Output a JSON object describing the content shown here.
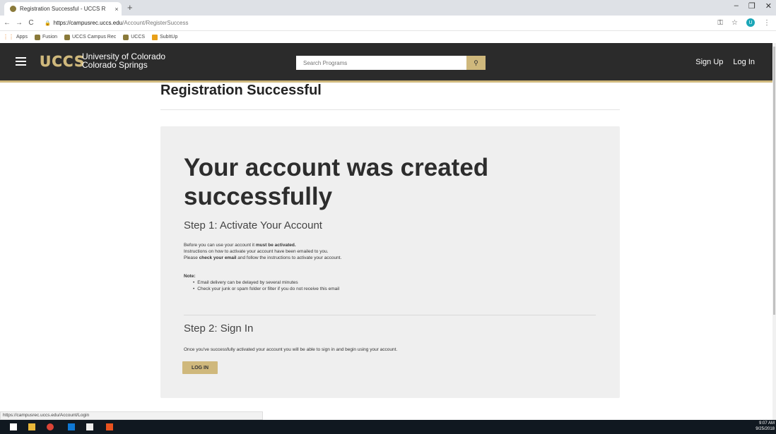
{
  "browser": {
    "tab_title": "Registration Successful - UCCS R",
    "tab_close": "×",
    "new_tab": "+",
    "url_host": "https://campusrec.uccs.edu",
    "url_path": "/Account/RegisterSuccess",
    "profile_initial": "U",
    "bookmarks": [
      "Apps",
      "Fusion",
      "UCCS Campus Rec",
      "UCCS",
      "SubItUp"
    ],
    "status_url": "https://campusrec.uccs.edu/Account/Login"
  },
  "header": {
    "logo": "UCCS",
    "univ_line1": "University of Colorado",
    "univ_line2": "Colorado Springs",
    "search_placeholder": "Search Programs",
    "sign_up": "Sign Up",
    "log_in": "Log In"
  },
  "page": {
    "title": "Registration Successful",
    "headline": "Your account was created successfully",
    "step1_title": "Step 1: Activate Your Account",
    "step1_line1_a": "Before you can use your account it ",
    "step1_line1_b": "must be activated.",
    "step1_line2": "Instructions on how to activate your account have been emailed to you.",
    "step1_line3_a": "Please ",
    "step1_line3_b": "check your email",
    "step1_line3_c": " and follow the instructions to activate your account.",
    "note_label": "Note:",
    "note_items": [
      "Email delivery can be delayed by several minutes",
      "Check your junk or spam folder or filter if you do not receive this email"
    ],
    "step2_title": "Step 2: Sign In",
    "step2_text": "Once you've successfully activated your account you will be able to sign in and begin using your account.",
    "login_button": "LOG IN"
  },
  "taskbar": {
    "time": "9:07 AM",
    "date": "9/25/2018"
  },
  "colors": {
    "gold": "#cfb87c",
    "header_bg": "#2b2b2b",
    "card_bg": "#efefef"
  }
}
